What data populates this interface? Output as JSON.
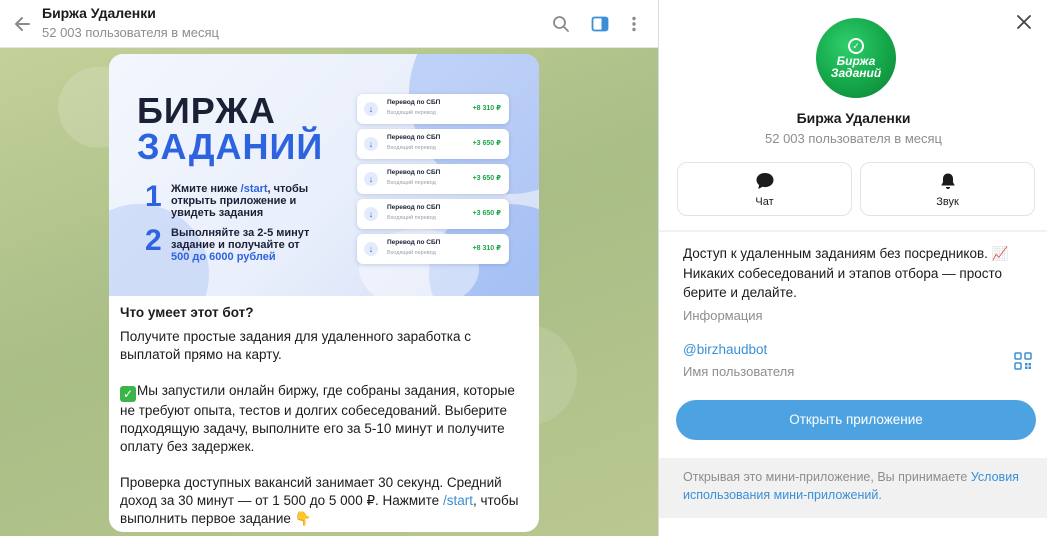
{
  "header": {
    "title": "Биржа Удаленки",
    "subtitle": "52 003 пользователя в месяц"
  },
  "banner": {
    "title_line1": "БИРЖА",
    "title_line2": "ЗАДАНИЙ",
    "step1_num": "1",
    "step1_pre": "Жмите ниже ",
    "step1_hl": "/start",
    "step1_post": ", чтобы открыть приложение и увидеть задания",
    "step2_num": "2",
    "step2_text": "Выполняйте за 2-5 минут задание и получайте от ",
    "step2_hl": "500 до 6000 рублей",
    "transfers": [
      {
        "title": "Перевод по СБП",
        "sub": "Входящий перевод",
        "amount": "+8 310 ₽"
      },
      {
        "title": "Перевод по СБП",
        "sub": "Входящий перевод",
        "amount": "+3 650 ₽"
      },
      {
        "title": "Перевод по СБП",
        "sub": "Входящий перевод",
        "amount": "+3 650 ₽"
      },
      {
        "title": "Перевод по СБП",
        "sub": "Входящий перевод",
        "amount": "+3 650 ₽"
      },
      {
        "title": "Перевод по СБП",
        "sub": "Входящий перевод",
        "amount": "+8 310 ₽"
      }
    ]
  },
  "message": {
    "question": "Что умеет этот бот?",
    "p1": "Получите простые задания для удаленного заработка с выплатой прямо на карту.",
    "p2": "Мы запустили онлайн биржу, где собраны задания, которые не требуют опыта, тестов и долгих собеседований. Выберите подходящую задачу, выполните его за 5-10 минут и получите оплату без задержек.",
    "p3_pre": "Проверка доступных вакансий занимает 30 секунд. Средний доход за 30 минут — от 1 500 до 5 000 ₽. Нажмите ",
    "p3_link": "/start",
    "p3_post": ", чтобы выполнить первое задание 👇"
  },
  "panel": {
    "avatar_text_1": "Биржа",
    "avatar_text_2": "Заданий",
    "name": "Биржа Удаленки",
    "subtitle": "52 003 пользователя в месяц",
    "action_chat": "Чат",
    "action_sound": "Звук",
    "description": "Доступ к удаленным заданиям без посредников. 📈 Никаких собеседований и этапов отбора — просто берите и делайте.",
    "info_label": "Информация",
    "username": "@birzhaudbot",
    "username_label": "Имя пользователя",
    "open_app": "Открыть приложение",
    "terms_text": "Открывая это мини-приложение, Вы принимаете ",
    "terms_link": "Условия использования мини-приложений."
  },
  "colors": {
    "accent": "#4da3e1",
    "link": "#3a8fd6",
    "brand_green": "#14a648",
    "banner_blue": "#2e63e0"
  }
}
